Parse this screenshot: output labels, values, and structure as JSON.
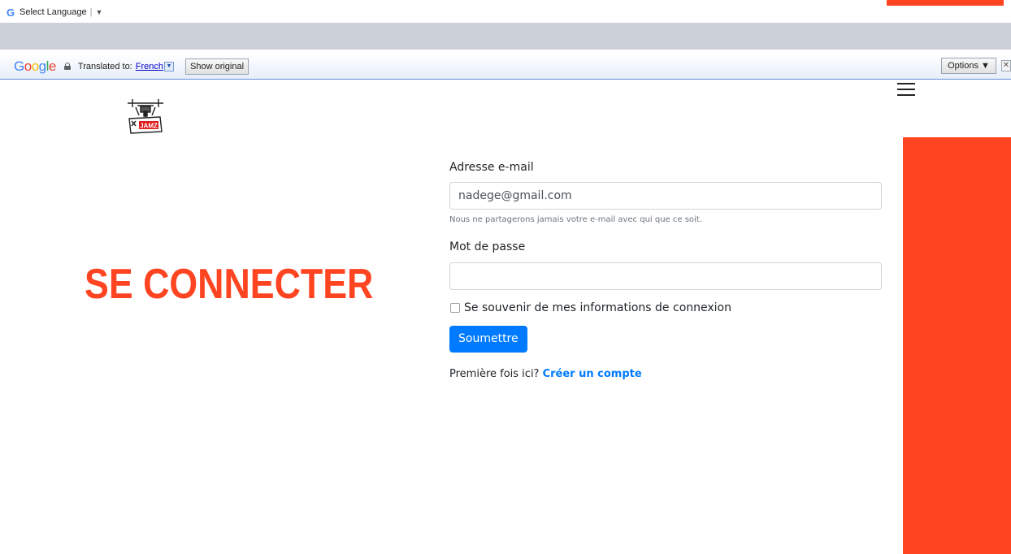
{
  "translate_gadget": {
    "label": "Select Language",
    "arrow": "▼"
  },
  "translate_banner": {
    "brand": "Google",
    "translated_to": "Translated to:",
    "language": "French",
    "show_original": "Show original",
    "options": "Options ▼",
    "close": "✕"
  },
  "header": {
    "logo_alt": "JAMZ drone logo",
    "menu_icon": "hamburger-icon"
  },
  "page": {
    "heading": "SE CONNECTER"
  },
  "form": {
    "email_label": "Adresse e-mail",
    "email_value": "nadege@gmail.com",
    "email_help": "Nous ne partagerons jamais votre e-mail avec qui que ce soit.",
    "password_label": "Mot de passe",
    "password_value": "",
    "remember_label": "Se souvenir de mes informations de connexion",
    "submit_label": "Soumettre",
    "first_time_text": "Première fois ici?",
    "create_account_link": "Créer un compte"
  },
  "colors": {
    "accent": "#ff4422",
    "primary": "#007bff",
    "band": "#ccd1d9"
  }
}
